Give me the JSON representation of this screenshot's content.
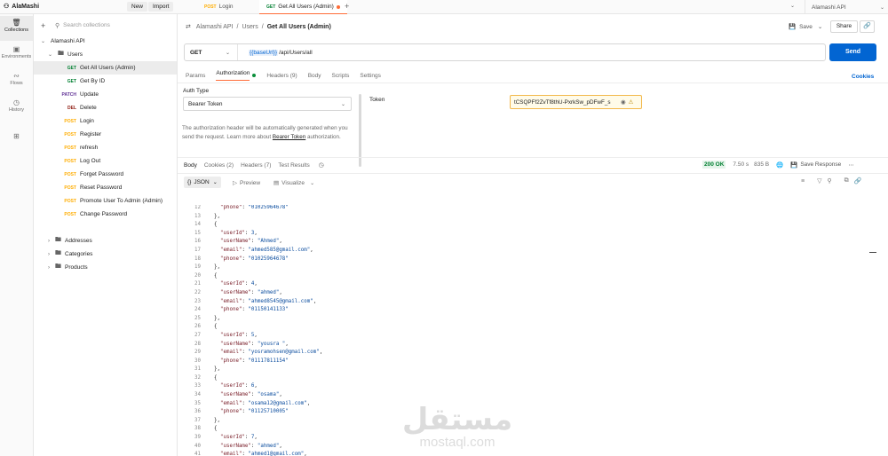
{
  "workspace": {
    "name": "AlaMashi",
    "new_label": "New",
    "import_label": "Import"
  },
  "tabs": [
    {
      "method": "POST",
      "label": "Login"
    },
    {
      "method": "GET",
      "label": "Get All Users (Admin)"
    }
  ],
  "environment": {
    "label": "Alamashi API"
  },
  "rail": [
    {
      "icon": "collections-icon",
      "label": "Collections"
    },
    {
      "icon": "environments-icon",
      "label": "Environments"
    },
    {
      "icon": "flows-icon",
      "label": "Flows"
    },
    {
      "icon": "history-icon",
      "label": "History"
    },
    {
      "icon": "apps-icon",
      "label": ""
    }
  ],
  "sidebar": {
    "search_placeholder": "Search collections",
    "collection": "Alamashi API",
    "folder_users": "Users",
    "requests": [
      {
        "method": "GET",
        "label": "Get All Users (Admin)"
      },
      {
        "method": "GET",
        "label": "Get By ID"
      },
      {
        "method": "PATCH",
        "label": "Update"
      },
      {
        "method": "DEL",
        "label": "Delete"
      },
      {
        "method": "POST",
        "label": "Login"
      },
      {
        "method": "POST",
        "label": "Register"
      },
      {
        "method": "POST",
        "label": "refresh"
      },
      {
        "method": "POST",
        "label": "Log Out"
      },
      {
        "method": "POST",
        "label": "Forget Password"
      },
      {
        "method": "POST",
        "label": "Reset Password"
      },
      {
        "method": "POST",
        "label": "Promote User To Admin (Admin)"
      },
      {
        "method": "POST",
        "label": "Change Password"
      }
    ],
    "folders": [
      "Addresses",
      "Categories",
      "Products"
    ]
  },
  "breadcrumb": {
    "part1": "Alamashi API",
    "sep": "/",
    "part2": "Users",
    "part3": "Get All Users (Admin)"
  },
  "actions": {
    "save": "Save",
    "share": "Share"
  },
  "request": {
    "method": "GET",
    "url_var": "{{baseUrl}}",
    "url_path": "/api/Users/all",
    "send": "Send"
  },
  "req_tabs": [
    "Params",
    "Authorization",
    "Headers (9)",
    "Body",
    "Scripts",
    "Settings"
  ],
  "cookies_link": "Cookies",
  "auth": {
    "type_label": "Auth Type",
    "type_value": "Bearer Token",
    "note": "The authorization header will be automatically generated when you send the request. Learn more about",
    "note_link": "Bearer Token",
    "note_end": "authorization.",
    "token_label": "Token",
    "token_value": "tCSQPFf2ZvTf8thU-PxrkSw_pDFwF_s"
  },
  "response": {
    "tabs": [
      "Body",
      "Cookies (2)",
      "Headers (7)",
      "Test Results"
    ],
    "status": "200 OK",
    "time": "7.50 s",
    "size": "835 B",
    "save_response": "Save Response",
    "format": "JSON",
    "preview": "Preview",
    "visualize": "Visualize"
  },
  "code_lines": [
    {
      "n": "12",
      "indent": 3,
      "parts": [
        [
          "key",
          "\"phone\""
        ],
        [
          "pun",
          ": "
        ],
        [
          "str",
          "\"01025964678\""
        ]
      ]
    },
    {
      "n": "13",
      "indent": 2,
      "parts": [
        [
          "pun",
          "},"
        ]
      ]
    },
    {
      "n": "14",
      "indent": 2,
      "parts": [
        [
          "pun",
          "{"
        ]
      ]
    },
    {
      "n": "15",
      "indent": 3,
      "parts": [
        [
          "key",
          "\"userId\""
        ],
        [
          "pun",
          ": "
        ],
        [
          "str",
          "3"
        ],
        [
          "pun",
          ","
        ]
      ]
    },
    {
      "n": "16",
      "indent": 3,
      "parts": [
        [
          "key",
          "\"userName\""
        ],
        [
          "pun",
          ": "
        ],
        [
          "str",
          "\"Ahmed\""
        ],
        [
          "pun",
          ","
        ]
      ]
    },
    {
      "n": "17",
      "indent": 3,
      "parts": [
        [
          "key",
          "\"email\""
        ],
        [
          "pun",
          ": "
        ],
        [
          "str",
          "\"ahmed585@gmail.com\""
        ],
        [
          "pun",
          ","
        ]
      ]
    },
    {
      "n": "18",
      "indent": 3,
      "parts": [
        [
          "key",
          "\"phone\""
        ],
        [
          "pun",
          ": "
        ],
        [
          "str",
          "\"01025964678\""
        ]
      ]
    },
    {
      "n": "19",
      "indent": 2,
      "parts": [
        [
          "pun",
          "},"
        ]
      ]
    },
    {
      "n": "20",
      "indent": 2,
      "parts": [
        [
          "pun",
          "{"
        ]
      ]
    },
    {
      "n": "21",
      "indent": 3,
      "parts": [
        [
          "key",
          "\"userId\""
        ],
        [
          "pun",
          ": "
        ],
        [
          "str",
          "4"
        ],
        [
          "pun",
          ","
        ]
      ]
    },
    {
      "n": "22",
      "indent": 3,
      "parts": [
        [
          "key",
          "\"userName\""
        ],
        [
          "pun",
          ": "
        ],
        [
          "str",
          "\"ahmed\""
        ],
        [
          "pun",
          ","
        ]
      ]
    },
    {
      "n": "23",
      "indent": 3,
      "parts": [
        [
          "key",
          "\"email\""
        ],
        [
          "pun",
          ": "
        ],
        [
          "str",
          "\"ahmed8545@gmail.com\""
        ],
        [
          "pun",
          ","
        ]
      ]
    },
    {
      "n": "24",
      "indent": 3,
      "parts": [
        [
          "key",
          "\"phone\""
        ],
        [
          "pun",
          ": "
        ],
        [
          "str",
          "\"01150141133\""
        ]
      ]
    },
    {
      "n": "25",
      "indent": 2,
      "parts": [
        [
          "pun",
          "},"
        ]
      ]
    },
    {
      "n": "26",
      "indent": 2,
      "parts": [
        [
          "pun",
          "{"
        ]
      ]
    },
    {
      "n": "27",
      "indent": 3,
      "parts": [
        [
          "key",
          "\"userId\""
        ],
        [
          "pun",
          ": "
        ],
        [
          "str",
          "5"
        ],
        [
          "pun",
          ","
        ]
      ]
    },
    {
      "n": "28",
      "indent": 3,
      "parts": [
        [
          "key",
          "\"userName\""
        ],
        [
          "pun",
          ": "
        ],
        [
          "str",
          "\"yousra \""
        ],
        [
          "pun",
          ","
        ]
      ]
    },
    {
      "n": "29",
      "indent": 3,
      "parts": [
        [
          "key",
          "\"email\""
        ],
        [
          "pun",
          ": "
        ],
        [
          "str",
          "\"yosramohsen@gmail.com\""
        ],
        [
          "pun",
          ","
        ]
      ]
    },
    {
      "n": "30",
      "indent": 3,
      "parts": [
        [
          "key",
          "\"phone\""
        ],
        [
          "pun",
          ": "
        ],
        [
          "str",
          "\"01117811154\""
        ]
      ]
    },
    {
      "n": "31",
      "indent": 2,
      "parts": [
        [
          "pun",
          "},"
        ]
      ]
    },
    {
      "n": "32",
      "indent": 2,
      "parts": [
        [
          "pun",
          "{"
        ]
      ]
    },
    {
      "n": "33",
      "indent": 3,
      "parts": [
        [
          "key",
          "\"userId\""
        ],
        [
          "pun",
          ": "
        ],
        [
          "str",
          "6"
        ],
        [
          "pun",
          ","
        ]
      ]
    },
    {
      "n": "34",
      "indent": 3,
      "parts": [
        [
          "key",
          "\"userName\""
        ],
        [
          "pun",
          ": "
        ],
        [
          "str",
          "\"osama\""
        ],
        [
          "pun",
          ","
        ]
      ]
    },
    {
      "n": "35",
      "indent": 3,
      "parts": [
        [
          "key",
          "\"email\""
        ],
        [
          "pun",
          ": "
        ],
        [
          "str",
          "\"osama12@gmail.com\""
        ],
        [
          "pun",
          ","
        ]
      ]
    },
    {
      "n": "36",
      "indent": 3,
      "parts": [
        [
          "key",
          "\"phone\""
        ],
        [
          "pun",
          ": "
        ],
        [
          "str",
          "\"01125710005\""
        ]
      ]
    },
    {
      "n": "37",
      "indent": 2,
      "parts": [
        [
          "pun",
          "},"
        ]
      ]
    },
    {
      "n": "38",
      "indent": 2,
      "parts": [
        [
          "pun",
          "{"
        ]
      ]
    },
    {
      "n": "39",
      "indent": 3,
      "parts": [
        [
          "key",
          "\"userId\""
        ],
        [
          "pun",
          ": "
        ],
        [
          "str",
          "7"
        ],
        [
          "pun",
          ","
        ]
      ]
    },
    {
      "n": "40",
      "indent": 3,
      "parts": [
        [
          "key",
          "\"userName\""
        ],
        [
          "pun",
          ": "
        ],
        [
          "str",
          "\"ahmed\""
        ],
        [
          "pun",
          ","
        ]
      ]
    },
    {
      "n": "41",
      "indent": 3,
      "parts": [
        [
          "key",
          "\"email\""
        ],
        [
          "pun",
          ": "
        ],
        [
          "str",
          "\"ahmed1@gmail.com\""
        ],
        [
          "pun",
          ","
        ]
      ]
    }
  ],
  "watermark": {
    "arabic": "مستقل",
    "latin": "mostaql.com"
  },
  "colors": {
    "accent": "#ff6c37",
    "send": "#0265d2",
    "status_ok": "#007f31"
  }
}
